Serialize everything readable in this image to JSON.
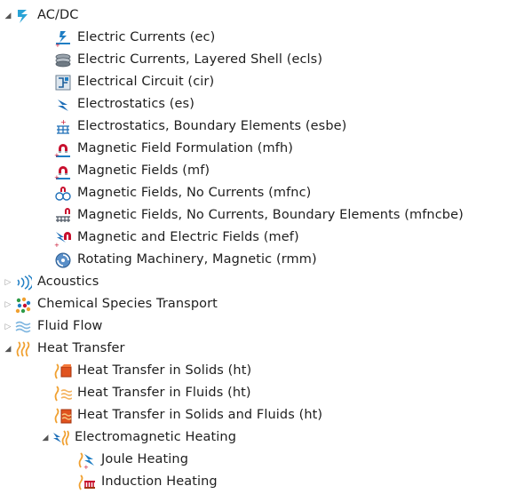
{
  "tree": {
    "acdc": {
      "label": "AC/DC",
      "icon": "acdc-lightning-icon"
    },
    "ec": {
      "label": "Electric Currents (ec)",
      "icon": "electric-currents-icon"
    },
    "ecls": {
      "label": "Electric Currents, Layered Shell (ecls)",
      "icon": "layered-shell-icon"
    },
    "cir": {
      "label": "Electrical Circuit (cir)",
      "icon": "circuit-icon"
    },
    "es": {
      "label": "Electrostatics (es)",
      "icon": "electrostatics-icon"
    },
    "esbe": {
      "label": "Electrostatics, Boundary Elements (esbe)",
      "icon": "boundary-elements-icon"
    },
    "mfh": {
      "label": "Magnetic Field Formulation (mfh)",
      "icon": "magnet-icon"
    },
    "mf": {
      "label": "Magnetic Fields (mf)",
      "icon": "magnet-icon"
    },
    "mfnc": {
      "label": "Magnetic Fields, No Currents (mfnc)",
      "icon": "no-currents-icon"
    },
    "mfncbe": {
      "label": "Magnetic Fields, No Currents, Boundary Elements (mfncbe)",
      "icon": "magnet-boundary-icon"
    },
    "mef": {
      "label": "Magnetic and Electric Fields (mef)",
      "icon": "magnetic-electric-icon"
    },
    "rmm": {
      "label": "Rotating Machinery, Magnetic (rmm)",
      "icon": "rotating-machinery-icon"
    },
    "acoustics": {
      "label": "Acoustics",
      "icon": "acoustics-icon"
    },
    "chem": {
      "label": "Chemical Species Transport",
      "icon": "chemical-species-icon"
    },
    "fluid": {
      "label": "Fluid Flow",
      "icon": "fluid-flow-icon"
    },
    "heat": {
      "label": "Heat Transfer",
      "icon": "heat-transfer-icon"
    },
    "ht_solids": {
      "label": "Heat Transfer in Solids (ht)",
      "icon": "heat-solid-icon"
    },
    "ht_fluids": {
      "label": "Heat Transfer in Fluids (ht)",
      "icon": "heat-fluid-icon"
    },
    "ht_solids_fluids": {
      "label": "Heat Transfer in Solids and Fluids (ht)",
      "icon": "heat-solid-fluid-icon"
    },
    "em_heating": {
      "label": "Electromagnetic Heating",
      "icon": "electromagnetic-heating-icon"
    },
    "joule": {
      "label": "Joule Heating",
      "icon": "joule-heating-icon"
    },
    "induction": {
      "label": "Induction Heating",
      "icon": "induction-heating-icon"
    }
  },
  "colors": {
    "acdc_blue": "#1f7ec4",
    "magnet_red": "#c8102e",
    "heat_orange": "#f0a030",
    "text": "#1e1e1e"
  }
}
